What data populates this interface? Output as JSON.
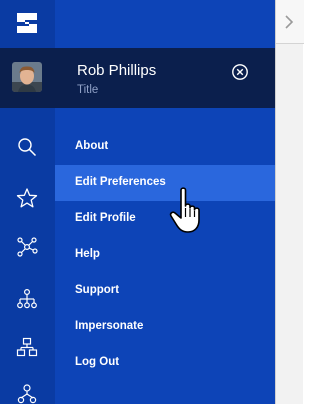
{
  "user": {
    "name": "Rob Phillips",
    "title": "Title"
  },
  "menu": {
    "items": [
      {
        "label": "About"
      },
      {
        "label": "Edit Preferences",
        "active": true
      },
      {
        "label": "Edit Profile"
      },
      {
        "label": "Help"
      },
      {
        "label": "Support"
      },
      {
        "label": "Impersonate"
      },
      {
        "label": "Log Out"
      }
    ]
  },
  "rail": {
    "icons": [
      "search-icon",
      "star-icon",
      "network-icon",
      "hierarchy-icon",
      "org-chart-icon",
      "group-icon"
    ]
  },
  "colors": {
    "rail": "#0a3ba3",
    "panel": "#0d44b7",
    "profile_bar": "#0b1f4d",
    "active_item": "#2a67dd"
  }
}
